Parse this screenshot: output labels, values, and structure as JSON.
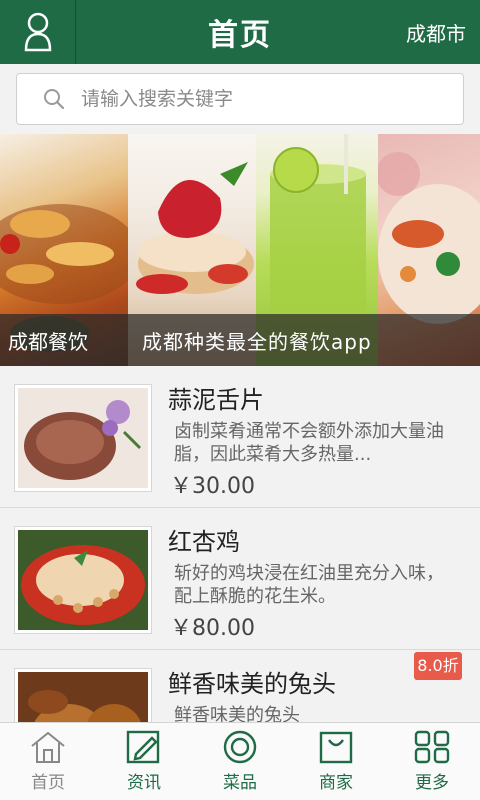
{
  "header": {
    "title": "首页",
    "city": "成都市",
    "user_icon": "user-icon"
  },
  "search": {
    "placeholder": "请输入搜索关键字",
    "icon": "search-icon"
  },
  "banner": {
    "caption_left": "成都餐饮",
    "caption_right": "成都种类最全的餐饮app"
  },
  "items": [
    {
      "name": "蒜泥舌片",
      "desc": "卤制菜肴通常不会额外添加大量油脂，因此菜肴大多热量...",
      "price": "￥30.00"
    },
    {
      "name": "红杏鸡",
      "desc": "斩好的鸡块浸在红油里充分入味，配上酥脆的花生米。",
      "price": "￥80.00"
    },
    {
      "name": "鲜香味美的兔头",
      "desc": "鲜香味美的兔头",
      "price": ""
    }
  ],
  "badge": {
    "text": "8.0折"
  },
  "nav": {
    "home": "首页",
    "news": "资讯",
    "dishes": "菜品",
    "merchants": "商家",
    "more": "更多"
  },
  "colors": {
    "brand": "#1e6b45",
    "badge": "#e85a4a"
  }
}
